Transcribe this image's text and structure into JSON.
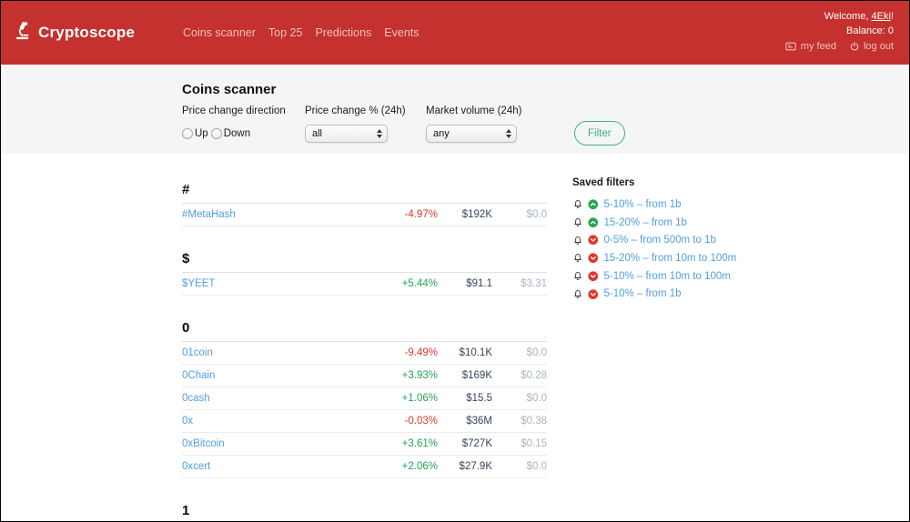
{
  "header": {
    "brand": "Cryptoscope",
    "nav": [
      {
        "id": "coins-scanner",
        "label": "Coins scanner"
      },
      {
        "id": "top-25",
        "label": "Top 25"
      },
      {
        "id": "predictions",
        "label": "Predictions"
      },
      {
        "id": "events",
        "label": "Events"
      }
    ],
    "welcome_prefix": "Welcome, ",
    "username": "4Eki",
    "welcome_suffix": "!",
    "balance_label": "Balance: 0",
    "my_feed_label": "my feed",
    "log_out_label": "log out"
  },
  "filters": {
    "title": "Coins scanner",
    "direction_label": "Price change direction",
    "up_label": "Up",
    "down_label": "Down",
    "change_label": "Price change % (24h)",
    "change_value": "all",
    "volume_label": "Market volume (24h)",
    "volume_value": "any",
    "filter_button": "Filter"
  },
  "coins": {
    "groups": [
      {
        "letter": "#",
        "rows": [
          {
            "name": "#MetaHash",
            "change": "-4.97%",
            "dir": "down",
            "volume": "$192K",
            "price": "$0.0"
          }
        ]
      },
      {
        "letter": "$",
        "rows": [
          {
            "name": "$YEET",
            "change": "+5.44%",
            "dir": "up",
            "volume": "$91.1",
            "price": "$3.31"
          }
        ]
      },
      {
        "letter": "0",
        "rows": [
          {
            "name": "01coin",
            "change": "-9.49%",
            "dir": "down",
            "volume": "$10.1K",
            "price": "$0.0"
          },
          {
            "name": "0Chain",
            "change": "+3.93%",
            "dir": "up",
            "volume": "$169K",
            "price": "$0.28"
          },
          {
            "name": "0cash",
            "change": "+1.06%",
            "dir": "up",
            "volume": "$15.5",
            "price": "$0.0"
          },
          {
            "name": "0x",
            "change": "-0.03%",
            "dir": "down",
            "volume": "$36M",
            "price": "$0.38"
          },
          {
            "name": "0xBitcoin",
            "change": "+3.61%",
            "dir": "up",
            "volume": "$727K",
            "price": "$0.15"
          },
          {
            "name": "0xcert",
            "change": "+2.06%",
            "dir": "up",
            "volume": "$27.9K",
            "price": "$0.0"
          }
        ]
      },
      {
        "letter": "1",
        "rows": []
      }
    ]
  },
  "saved_filters": {
    "title": "Saved filters",
    "items": [
      {
        "label": "5-10% – from 1b",
        "direction": "up"
      },
      {
        "label": "15-20% – from 1b",
        "direction": "up"
      },
      {
        "label": "0-5% – from 500m to 1b",
        "direction": "down"
      },
      {
        "label": "15-20% – from 10m to 100m",
        "direction": "down"
      },
      {
        "label": "5-10% – from 10m to 100m",
        "direction": "down"
      },
      {
        "label": "5-10% – from 1b",
        "direction": "down"
      }
    ]
  },
  "colors": {
    "header_bg": "#c4312e",
    "nav_pink": "#f0c1be",
    "band_bg": "#f3f5f6",
    "link_blue": "#4f9fe0",
    "up_green": "#27a455",
    "down_red": "#e0382d",
    "button_green": "#47b07c",
    "volume_dark": "#36455b",
    "price_gray": "#a9b5c2"
  }
}
